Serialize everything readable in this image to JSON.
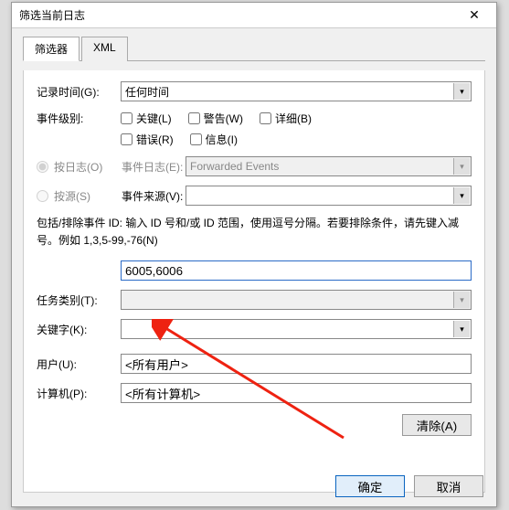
{
  "titlebar": {
    "title": "筛选当前日志"
  },
  "tabs": {
    "filter": "筛选器",
    "xml": "XML"
  },
  "labels": {
    "logged": "记录时间(G):",
    "level": "事件级别:",
    "bylog": "按日志(O)",
    "bysource": "按源(S)",
    "eventlogs": "事件日志(E):",
    "eventsources": "事件来源(V):",
    "help": "包括/排除事件 ID: 输入 ID 号和/或 ID 范围，使用逗号分隔。若要排除条件，请先键入减号。例如 1,3,5-99,-76(N)",
    "task": "任务类别(T):",
    "keywords": "关键字(K):",
    "user": "用户(U):",
    "computer": "计算机(P):",
    "clear": "清除(A)",
    "ok": "确定",
    "cancel": "取消"
  },
  "values": {
    "logged": "任何时间",
    "eventlogs": "Forwarded Events",
    "eventids": "6005,6006",
    "user": "<所有用户>",
    "computer": "<所有计算机>"
  },
  "checkboxes": {
    "critical": "关键(L)",
    "warning": "警告(W)",
    "verbose": "详细(B)",
    "error": "错误(R)",
    "info": "信息(I)"
  }
}
